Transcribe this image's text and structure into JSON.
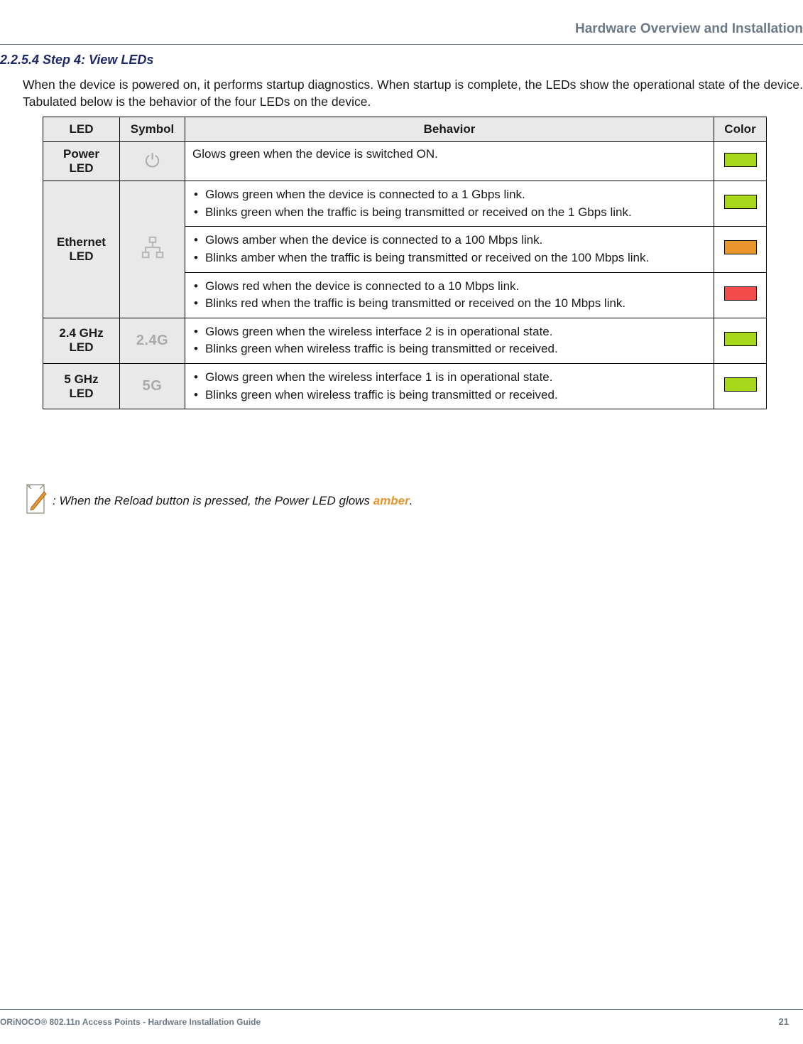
{
  "header_title": "Hardware Overview and Installation",
  "section_heading": "2.2.5.4 Step 4: View LEDs",
  "intro_text": "When the device is powered on, it performs startup diagnostics. When startup is complete, the LEDs show the operational state of the device. Tabulated below is the behavior of the four LEDs on the device.",
  "table": {
    "headers": {
      "led": "LED",
      "symbol": "Symbol",
      "behavior": "Behavior",
      "color": "Color"
    },
    "power": {
      "name": "Power\nLED",
      "behavior_single": "Glows green when the device is switched ON.",
      "color": "#a7d81c"
    },
    "ethernet": {
      "name": "Ethernet\nLED",
      "green": {
        "items": [
          "Glows green when the device is connected to a 1 Gbps link.",
          "Blinks green when the traffic is being transmitted or received on the 1 Gbps link."
        ],
        "color": "#a7d81c"
      },
      "amber": {
        "items": [
          "Glows amber when the device is connected to a 100 Mbps link.",
          "Blinks amber when the traffic is being transmitted or received on the 100 Mbps link."
        ],
        "color": "#e8962c"
      },
      "red": {
        "items": [
          "Glows red when the device is connected to a 10 Mbps link.",
          "Blinks red when the traffic is being transmitted or received on the 10 Mbps link."
        ],
        "color": "#f34a4a"
      }
    },
    "ghz24": {
      "name": "2.4 GHz\nLED",
      "symbol_text": "2.4G",
      "items": [
        "Glows green when the wireless interface 2 is in operational state.",
        "Blinks green when wireless traffic is being transmitted or received."
      ],
      "color": "#a7d81c"
    },
    "ghz5": {
      "name": "5 GHz\nLED",
      "symbol_text": "5G",
      "items": [
        "Glows green when the wireless interface 1 is in operational state.",
        "Blinks green when wireless traffic is being transmitted or received."
      ],
      "color": "#a7d81c"
    }
  },
  "note": {
    "prefix": ": When the Reload button is pressed, the Power LED glows ",
    "amber_word": "amber",
    "suffix": "."
  },
  "footer": {
    "left": "ORiNOCO® 802.11n Access Points - Hardware Installation Guide",
    "page": "21"
  }
}
